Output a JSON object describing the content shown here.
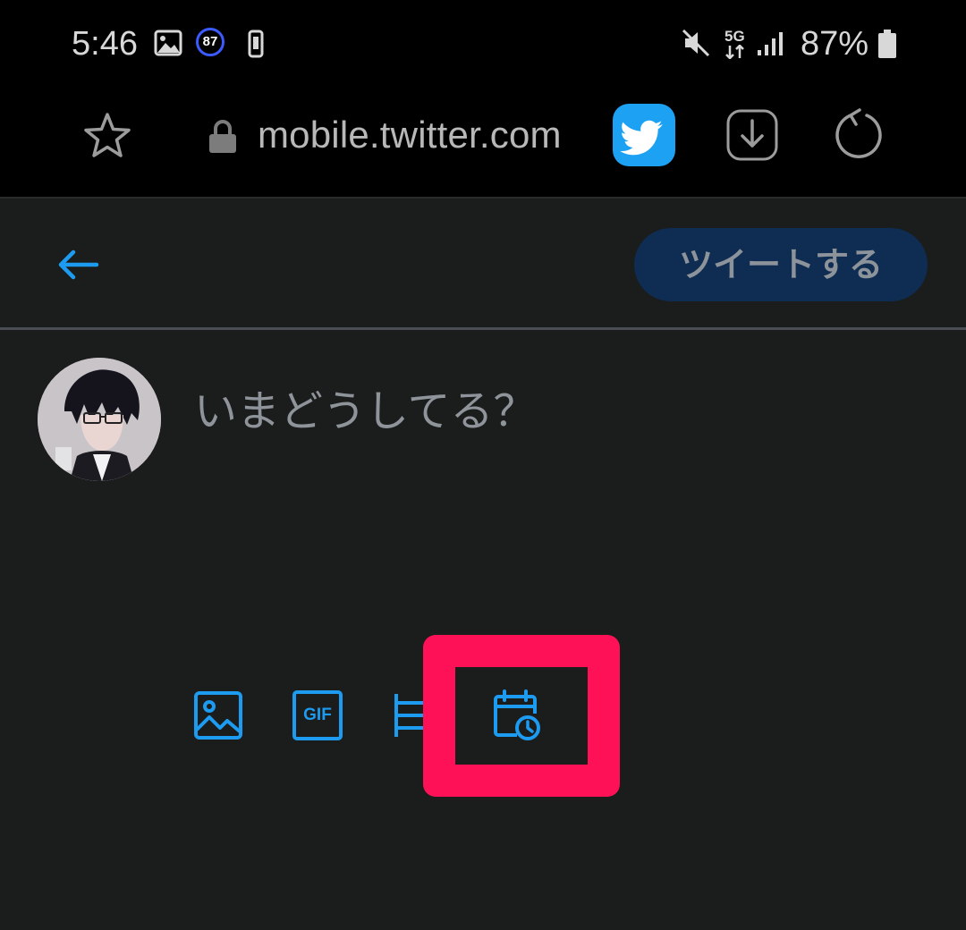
{
  "status_bar": {
    "time": "5:46",
    "notification_badge": "87",
    "network": "5G",
    "battery_percent": "87%",
    "icons": [
      "image-icon",
      "phone-vibrate-icon",
      "mute-icon",
      "signal-icon",
      "battery-icon"
    ]
  },
  "browser": {
    "url": "mobile.twitter.com",
    "icons": [
      "star-icon",
      "lock-icon",
      "twitter-bird-icon",
      "download-icon",
      "refresh-icon"
    ]
  },
  "compose_header": {
    "tweet_button_label": "ツイートする"
  },
  "compose": {
    "placeholder": "いまどうしてる？"
  },
  "toolbar": {
    "icons": [
      "image-icon",
      "gif-icon",
      "poll-icon",
      "schedule-icon"
    ],
    "gif_label": "GIF"
  },
  "colors": {
    "background": "#1b1c1c",
    "accent": "#1d9bf0",
    "tweet_button_bg": "#0f2c52",
    "highlight": "#ff1157"
  }
}
